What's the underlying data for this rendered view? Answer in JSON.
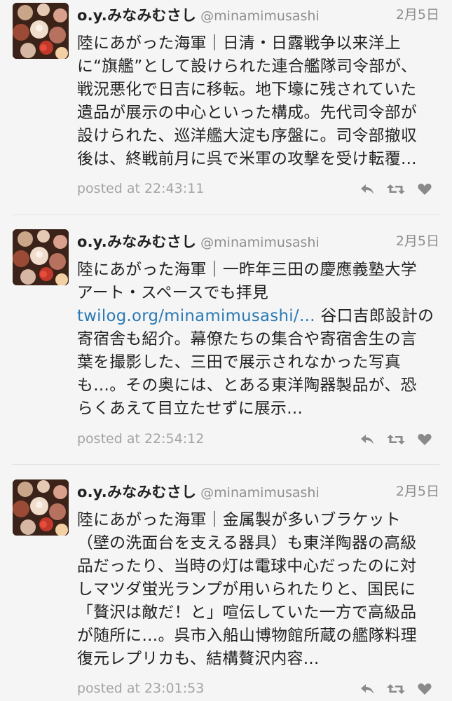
{
  "tweets": [
    {
      "name": "o.y.みなみむさし",
      "handle": "@minamimusashi",
      "date": "2月5日",
      "text_lines": [
        "陸にあがった海軍｜日清・日露戦争以来洋上",
        "に“旗艦”として設けられた連合艦隊司令部が、",
        "戦況悪化で日吉に移転。地下壕に残されていた",
        "遺品が展示の中心といった構成。先代司令部が",
        "設けられた、巡洋艦大淀も序盤に。司令部撤収",
        "後は、終戦前月に呉で米軍の攻撃を受け転覆…"
      ],
      "posted": "posted at 22:43:11"
    },
    {
      "name": "o.y.みなみむさし",
      "handle": "@minamimusashi",
      "date": "2月5日",
      "text_lines": [
        "陸にあがった海軍｜一昨年三田の慶應義塾大学",
        "アート・スペースでも拝見",
        "寄宿舎も紹介。幕僚たちの集合や寄宿舎生の言",
        "葉を撮影した、三田で展示されなかった写真",
        "も…。その奥には、とある東洋陶器製品が、恐",
        "らくあえて目立たせずに展示…"
      ],
      "link_text": "twilog.org/minamimusashi/…",
      "link_suffix": " 谷口吉郎設計の",
      "posted": "posted at 22:54:12"
    },
    {
      "name": "o.y.みなみむさし",
      "handle": "@minamimusashi",
      "date": "2月5日",
      "text_lines": [
        "陸にあがった海軍｜金属製が多いブラケット",
        "（壁の洗面台を支える器具）も東洋陶器の高級",
        "品だったり、当時の灯は電球中心だったのに対",
        "しマツダ蛍光ランプが用いられたりと、国民に",
        "「贅沢は敵だ！と」喧伝していた一方で高級品",
        "が随所に…。呉市入船山博物館所蔵の艦隊料理",
        "復元レプリカも、結構贅沢内容…"
      ],
      "posted": "posted at 23:01:53"
    }
  ],
  "icons": {
    "reply": "reply-icon",
    "retweet": "retweet-icon",
    "favorite": "heart-icon"
  },
  "colors": {
    "background": "#f5f5f5",
    "link": "#2a7ab5",
    "meta": "#8f8f8f",
    "icon": "#8a8a8a"
  }
}
